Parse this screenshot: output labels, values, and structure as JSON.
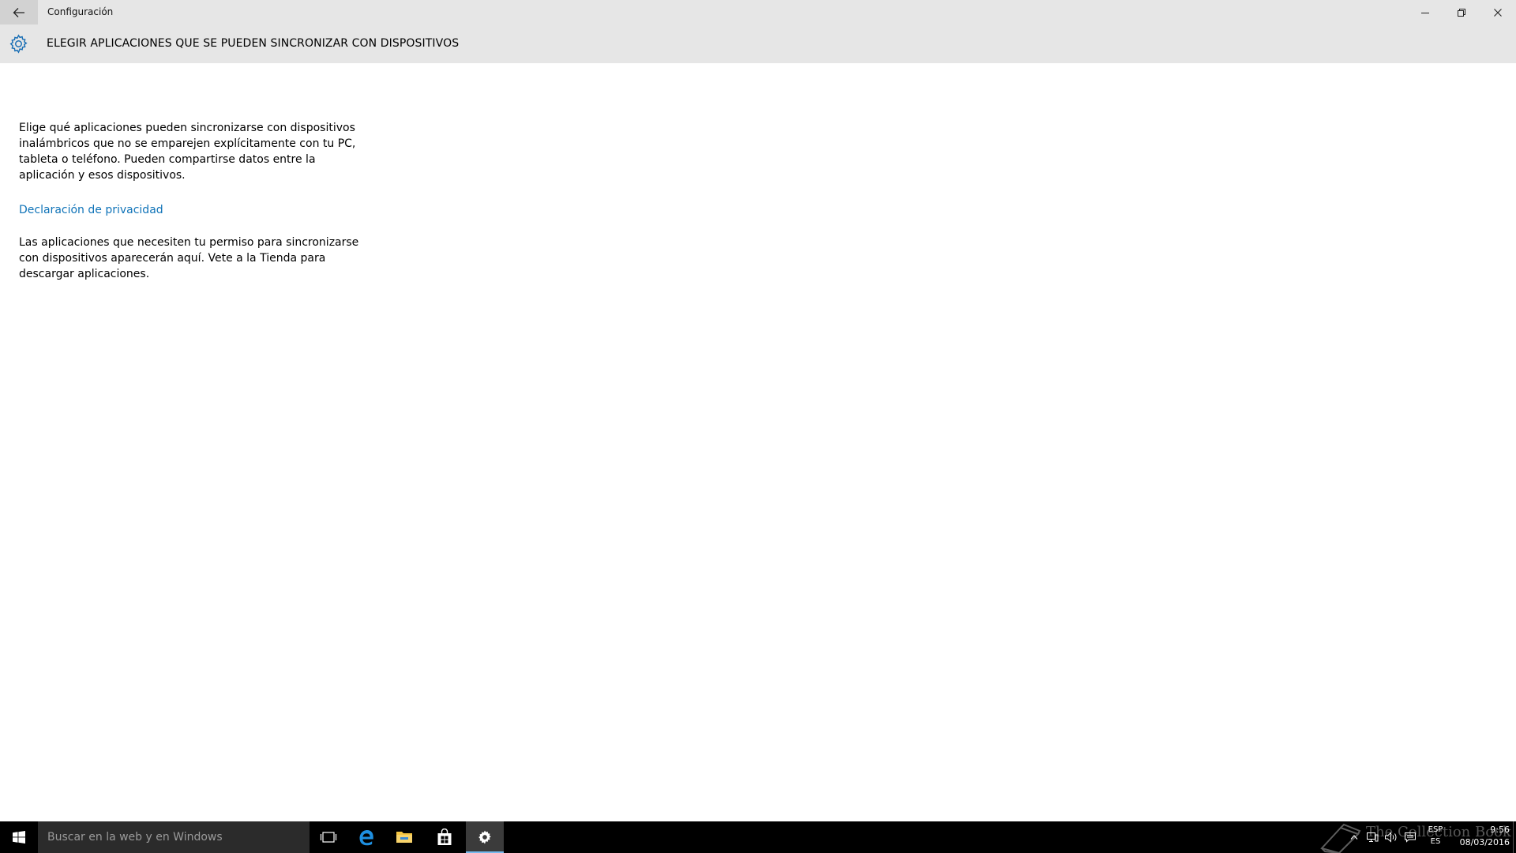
{
  "window": {
    "title": "Configuración",
    "icons": {
      "back": "back-arrow-icon",
      "minimize": "minimize-icon",
      "maximize": "restore-icon",
      "close": "close-icon"
    }
  },
  "header": {
    "title": "ELEGIR APLICACIONES QUE SE PUEDEN SINCRONIZAR CON DISPOSITIVOS",
    "icon": "gear-icon"
  },
  "content": {
    "description": "Elige qué aplicaciones pueden sincronizarse con dispositivos inalámbricos que no se emparejen explícitamente con tu PC, tableta o teléfono. Pueden compartirse datos entre la aplicación y esos dispositivos.",
    "privacy_link": "Declaración de privacidad",
    "note": "Las aplicaciones que necesiten tu permiso para sincronizarse con dispositivos aparecerán aquí. Vete a la Tienda para descargar aplicaciones."
  },
  "taskbar": {
    "search_placeholder": "Buscar en la web y en Windows",
    "apps": [
      "start-icon",
      "task-view-icon",
      "edge-icon",
      "file-explorer-icon",
      "store-icon",
      "settings-icon"
    ],
    "active_app": "settings-icon",
    "watermark": "The Collection Book",
    "tray": {
      "language_top": "ESP",
      "language_bottom": "ES",
      "time": "9:56",
      "date": "08/03/2016"
    }
  },
  "colors": {
    "titlebar_bg": "#e6e6e6",
    "accent_link": "#0f73b8",
    "taskbar_bg": "#000000",
    "search_bg": "#2b2b2b",
    "active_indicator": "#76b9ed"
  }
}
